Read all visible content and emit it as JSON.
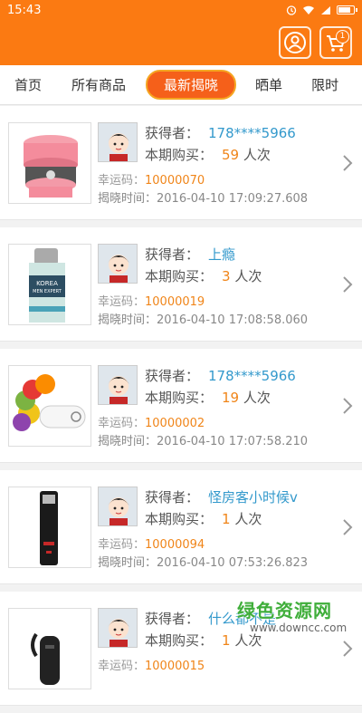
{
  "status_bar": {
    "time": "15:43"
  },
  "header": {
    "cart_badge": "1",
    "icons": [
      "user-icon",
      "cart-icon"
    ]
  },
  "tabs": [
    {
      "label": "首页"
    },
    {
      "label": "所有商品"
    },
    {
      "label": "最新揭晓",
      "active": true
    },
    {
      "label": "晒单"
    },
    {
      "label": "限时"
    }
  ],
  "labels": {
    "winner": "获得者：",
    "bought": "本期购买：",
    "times_unit": "人次",
    "lucky": "幸运码：",
    "reveal_time": "揭晓时间："
  },
  "items": [
    {
      "product": "lunch-box",
      "winner": "178****5966",
      "count": "59",
      "lucky_code": "10000070",
      "time": "2016-04-10 17:09:27.608"
    },
    {
      "product": "lotion-bottle",
      "winner": "上瘾",
      "count": "3",
      "lucky_code": "10000019",
      "time": "2016-04-10 17:08:58.060"
    },
    {
      "product": "usb-drive-colorful",
      "winner": "178****5966",
      "count": "19",
      "lucky_code": "10000002",
      "time": "2016-04-10 17:07:58.210"
    },
    {
      "product": "usb-flash-drive",
      "winner": "怪房客小时候v",
      "count": "1",
      "lucky_code": "10000094",
      "time": "2016-04-10 07:53:26.823"
    },
    {
      "product": "bluetooth-headset",
      "winner": "什么都不是",
      "count": "1",
      "lucky_code": "10000015",
      "time": ""
    }
  ],
  "watermark": {
    "title": "绿色资源网",
    "url": "www.downcc.com"
  },
  "colors": {
    "brand": "#fb7a12",
    "winner": "#3399cc",
    "count": "#f08519"
  }
}
